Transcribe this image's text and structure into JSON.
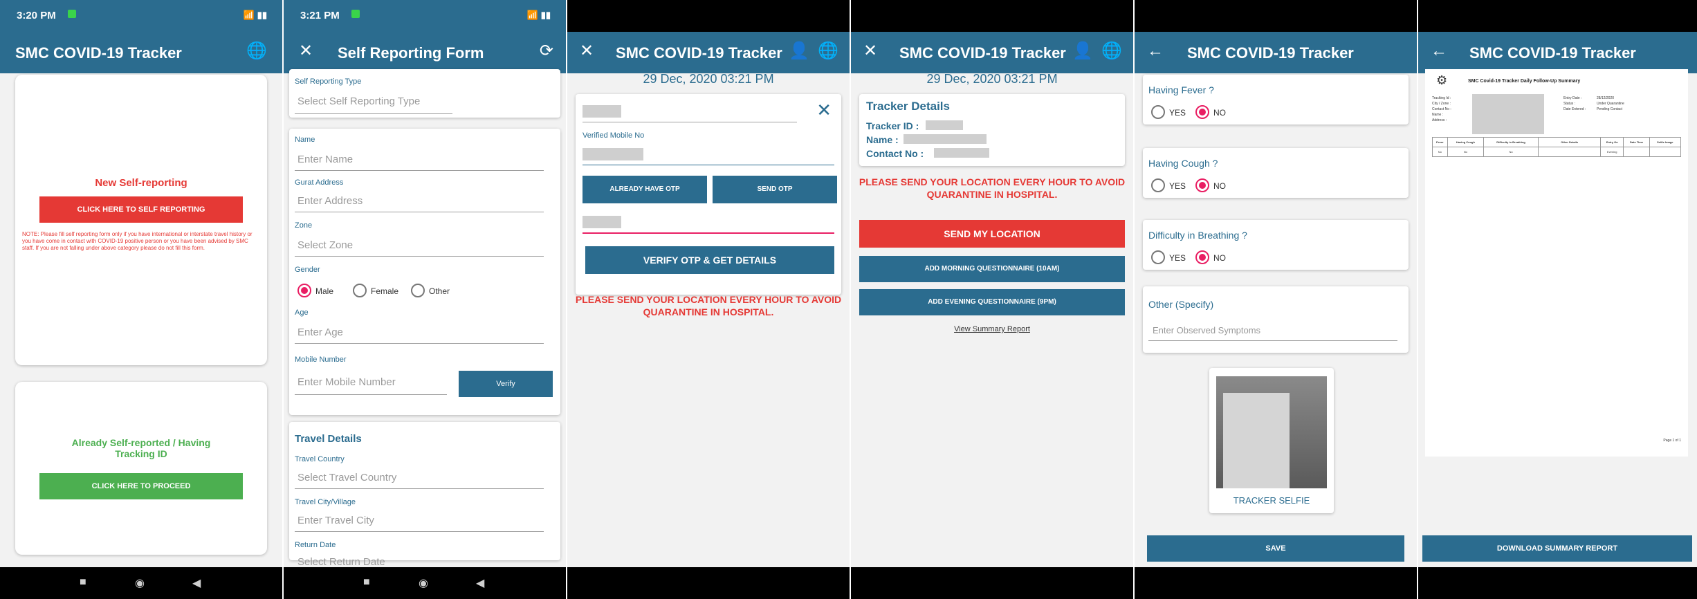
{
  "screen1": {
    "status_time": "3:20 PM",
    "status_right": "📶 ▮▮",
    "title": "SMC COVID-19 Tracker",
    "new_heading": "New Self-reporting",
    "self_report_button": "CLICK HERE TO SELF REPORTING",
    "note": "NOTE: Please fill self reporting form only if you have international or interstate travel history or you have come in contact with COVID-19 positive person or you have been advised by SMC staff. If you are not falling under above category please do not fill this form.",
    "already_heading": "Already Self-reported / Having Tracking ID",
    "proceed_button": "CLICK HERE TO PROCEED"
  },
  "screen2": {
    "status_time": "3:21 PM",
    "title": "Self Reporting Form",
    "fields": [
      {
        "label": "Self Reporting Type",
        "placeholder": "Select Self Reporting Type"
      },
      {
        "label": "Name",
        "placeholder": "Enter Name"
      },
      {
        "label": "Gurat Address",
        "placeholder": "Enter Address"
      },
      {
        "label": "Zone",
        "placeholder": "Select Zone"
      }
    ],
    "gender_label": "Gender",
    "gender_options": [
      "Male",
      "Female",
      "Other"
    ],
    "age_label": "Age",
    "age_placeholder": "Enter Age",
    "mobile_label": "Mobile Number",
    "mobile_placeholder": "Enter Mobile Number",
    "verify_button": "Verify",
    "travel_heading": "Travel Details",
    "travel_fields": [
      {
        "label": "Travel Country",
        "placeholder": "Select Travel Country"
      },
      {
        "label": "Travel City/Village",
        "placeholder": "Enter Travel City"
      },
      {
        "label": "Return Date",
        "placeholder": "Select Return Date"
      }
    ]
  },
  "screen3": {
    "title": "SMC COVID-19 Tracker",
    "datetime": "29 Dec, 2020 03:21 PM",
    "verified_label": "Verified Mobile No",
    "already_otp_button": "ALREADY HAVE OTP",
    "send_otp_button": "SEND OTP",
    "verify_button": "VERIFY OTP & GET DETAILS",
    "message": "PLEASE SEND YOUR LOCATION EVERY HOUR TO AVOID QUARANTINE IN HOSPITAL."
  },
  "screen4": {
    "title": "SMC COVID-19 Tracker",
    "datetime": "29 Dec, 2020 03:21 PM",
    "details_heading": "Tracker Details",
    "tracker_id_label": "Tracker ID :",
    "name_label": "Name :",
    "contact_label": "Contact No :",
    "message": "PLEASE SEND YOUR LOCATION EVERY HOUR TO AVOID QUARANTINE IN HOSPITAL.",
    "send_location_button": "SEND MY LOCATION",
    "morning_button": "ADD MORNING QUESTIONNAIRE (10AM)",
    "evening_button": "ADD EVENING QUESTIONNAIRE (9PM)",
    "summary_link": "View Summary Report"
  },
  "screen5": {
    "title": "SMC COVID-19 Tracker",
    "questions": [
      "Having Fever ?",
      "Having Cough ?",
      "Difficulty in Breathing ?"
    ],
    "yes": "YES",
    "no": "NO",
    "other_label": "Other (Specify)",
    "other_placeholder": "Enter Observed Symptoms",
    "selfie_label": "TRACKER SELFIE",
    "save_button": "SAVE"
  },
  "screen6": {
    "title": "SMC COVID-19 Tracker",
    "report_title": "SMC Covid-19 Tracker Daily Follow-Up Summary",
    "report_fields_left": [
      "Tracking Id :",
      "City / Zone :",
      "Contact No :",
      "Name :",
      "Address :"
    ],
    "report_fields_right": [
      "Entry Date :",
      "Status :",
      "Date Entered :"
    ],
    "report_values_right": [
      "28/12/2020",
      "Under Quarantine",
      "Pending Contact"
    ],
    "table_headers": [
      "Fever",
      "Having Cough",
      "Difficulty in Breathing",
      "Other Details",
      "Entry On",
      "Date Time",
      "Selfie Image"
    ],
    "table_row": [
      "No",
      "No",
      "No",
      "",
      "Evening",
      "",
      ""
    ],
    "page_label": "Page 1 of 1",
    "download_button": "DOWNLOAD SUMMARY REPORT"
  }
}
